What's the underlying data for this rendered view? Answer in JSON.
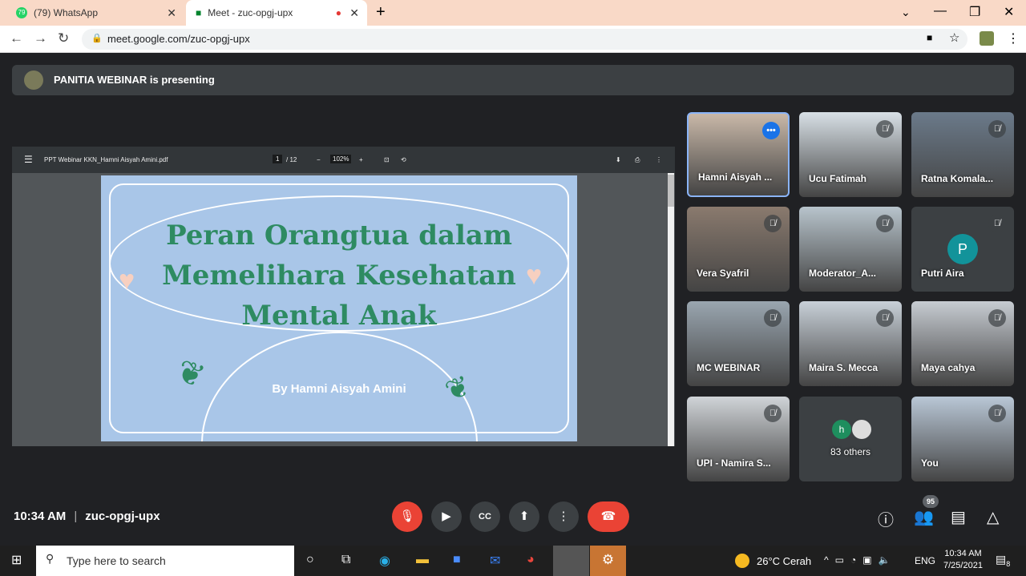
{
  "browser": {
    "tabs": [
      {
        "label": "(79) WhatsApp",
        "badge": "79"
      },
      {
        "label": "Meet - zuc-opgj-upx"
      }
    ],
    "url": "meet.google.com/zuc-opgj-upx"
  },
  "banner": {
    "text": "PANITIA WEBINAR is presenting"
  },
  "pdf": {
    "filename": "PPT Webinar KKN_Hamni Aisyah Amini.pdf",
    "page": "1",
    "total": "/ 12",
    "zoom": "102%"
  },
  "slide": {
    "title_lines": [
      "Peran Orangtua dalam",
      "Memelihara Kesehatan",
      "Mental Anak"
    ],
    "byline": "By Hamni Aisyah Amini"
  },
  "participants": [
    {
      "name": "Hamni Aisyah ...",
      "color": "#c9b8a8"
    },
    {
      "name": "Ucu Fatimah",
      "color": "#d8e0e6"
    },
    {
      "name": "Ratna Komala...",
      "color": "#6b7a8a"
    },
    {
      "name": "Vera Syafril",
      "color": "#8a7a6e"
    },
    {
      "name": "Moderator_A...",
      "color": "#b8c4cc"
    },
    {
      "name": "Putri Aira",
      "avatar": "P"
    },
    {
      "name": "MC WEBINAR",
      "color": "#9aa6b0"
    },
    {
      "name": "Maira S. Mecca",
      "color": "#c8d0d8"
    },
    {
      "name": "Maya cahya",
      "color": "#c7ccd2"
    },
    {
      "name": "UPI - Namira S...",
      "color": "#d0d4d8"
    },
    {
      "name": "83 others",
      "avatar": "h"
    },
    {
      "name": "You",
      "color": "#b9c7d6"
    }
  ],
  "footer": {
    "time": "10:34 AM",
    "code": "zuc-opgj-upx",
    "people_count": "95"
  },
  "taskbar": {
    "search": "Type here to search",
    "weather": "26°C  Cerah",
    "lang": "ENG",
    "time": "10:34 AM",
    "date": "7/25/2021",
    "notifications": "8"
  }
}
